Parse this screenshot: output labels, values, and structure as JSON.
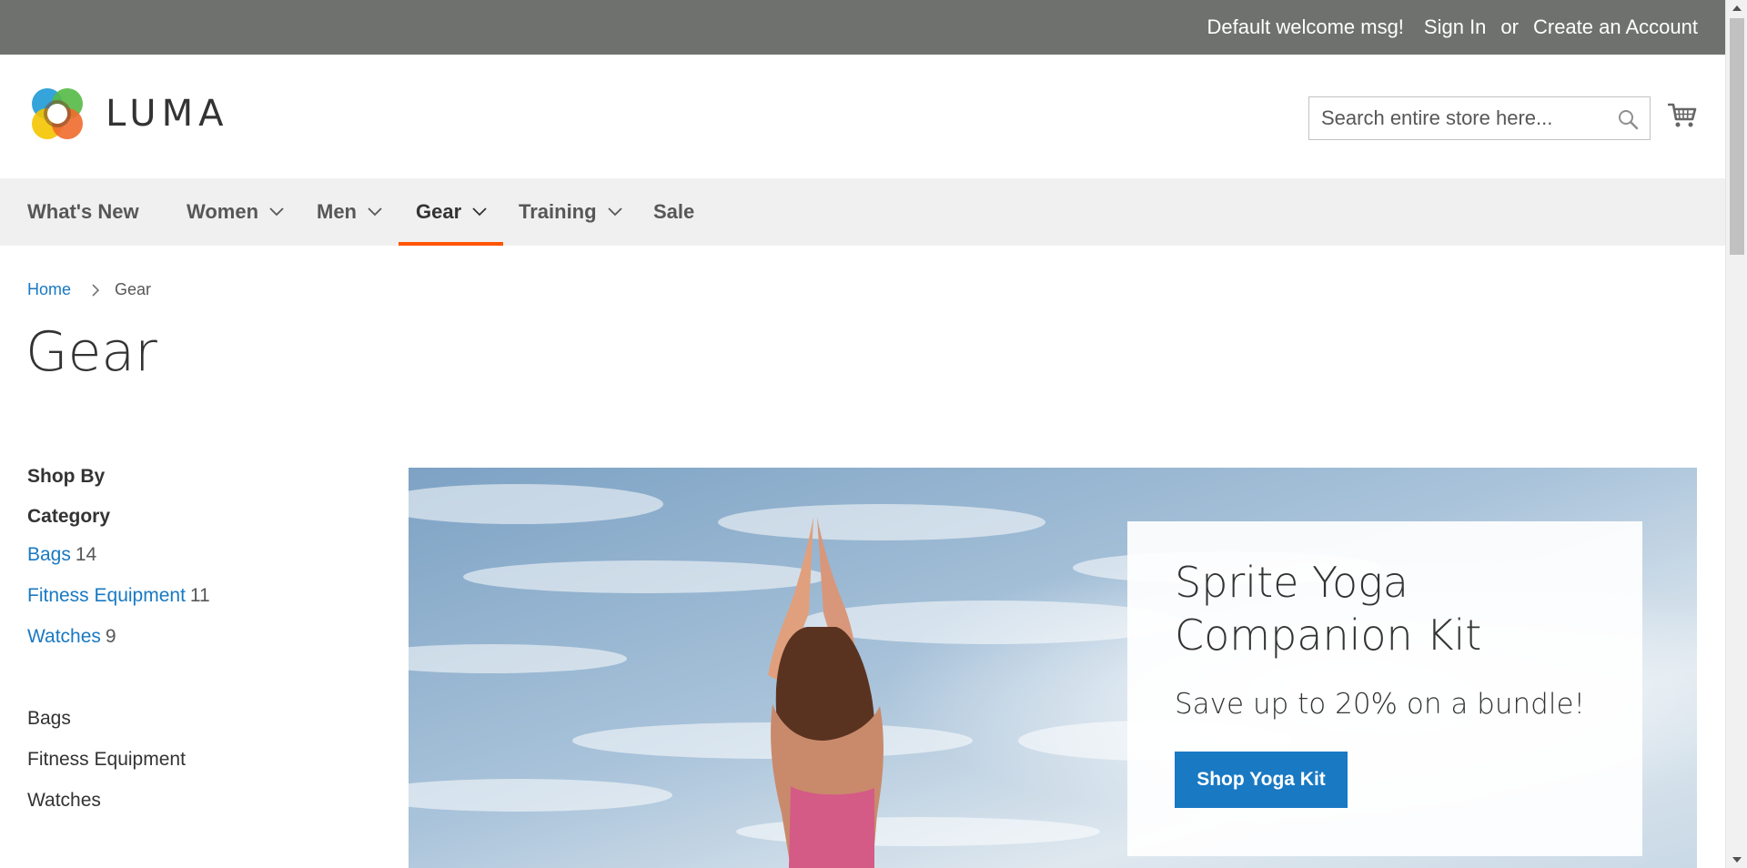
{
  "header_panel": {
    "welcome": "Default welcome msg!",
    "sign_in": "Sign In",
    "or": "or",
    "create_account": "Create an Account"
  },
  "logo": {
    "wordmark": "LUMA"
  },
  "search": {
    "placeholder": "Search entire store here..."
  },
  "nav": {
    "items": [
      {
        "label": "What's New",
        "has_dropdown": false,
        "active": false
      },
      {
        "label": "Women",
        "has_dropdown": true,
        "active": false
      },
      {
        "label": "Men",
        "has_dropdown": true,
        "active": false
      },
      {
        "label": "Gear",
        "has_dropdown": true,
        "active": true
      },
      {
        "label": "Training",
        "has_dropdown": true,
        "active": false
      },
      {
        "label": "Sale",
        "has_dropdown": false,
        "active": false
      }
    ]
  },
  "breadcrumbs": {
    "home": "Home",
    "current": "Gear"
  },
  "page_title": "Gear",
  "sidebar": {
    "shop_by": "Shop By",
    "filter_title": "Category",
    "filters": [
      {
        "label": "Bags",
        "count": "14"
      },
      {
        "label": "Fitness Equipment",
        "count": "11"
      },
      {
        "label": "Watches",
        "count": "9"
      }
    ],
    "categories": [
      "Bags",
      "Fitness Equipment",
      "Watches"
    ]
  },
  "promo": {
    "title": "Sprite Yoga Companion Kit",
    "subtitle": "Save up to 20% on a bundle!",
    "button": "Shop Yoga Kit"
  },
  "colors": {
    "panel_bg": "#6e716e",
    "nav_bg": "#f0f0f0",
    "active_underline": "#ff5501",
    "link": "#1979c3",
    "button": "#1979c3"
  }
}
